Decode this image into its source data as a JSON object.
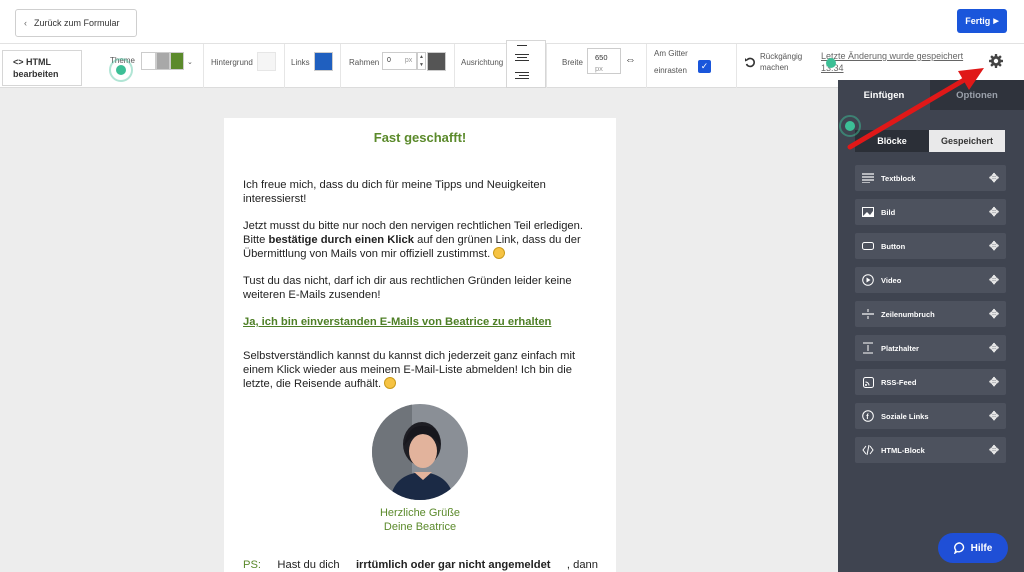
{
  "topbar": {
    "back_label": "Zurück zum Formular",
    "done_label": "Fertig"
  },
  "toolbar": {
    "html_label_line1": "HTML",
    "html_label_line2": "bearbeiten",
    "theme_label": "Theme",
    "background_label": "Hintergrund",
    "links_label": "Links",
    "frame_label": "Rahmen",
    "frame_value": "0",
    "frame_unit": "px",
    "alignment_label": "Ausrichtung",
    "width_label": "Breite",
    "width_value": "650",
    "width_unit": "px",
    "grid_label_line1": "Am Gitter",
    "grid_label_line2": "einrasten",
    "undo_label_line1": "Rückgängig",
    "undo_label_line2": "machen",
    "last_change": "Letzte Änderung wurde gespeichert 13:34",
    "colors": {
      "theme_1": "#ffffff",
      "theme_2": "#a8a8a8",
      "theme_3": "#5b8a2b",
      "links": "#1f5fbf",
      "frame": "#555555",
      "background": "#f5f5f5"
    }
  },
  "mail": {
    "title": "Fast geschafft!",
    "p1": "Ich freue mich, dass du dich für meine Tipps und Neuigkeiten interessierst!",
    "p2_a": "Jetzt musst du bitte nur noch den nervigen rechtlichen Teil erledigen. Bitte ",
    "p2_bold": "bestätige durch einen Klick",
    "p2_b": " auf den grünen Link, dass du der Übermittlung von Mails von mir offiziell zustimmst.",
    "p3": "Tust du das nicht, darf ich dir aus rechtlichen Gründen leider keine weiteren E-Mails zusenden!",
    "link": "Ja, ich bin einverstanden E-Mails von Beatrice zu erhalten",
    "p4": "Selbstverständlich kannst du kannst dich jederzeit ganz einfach mit einem Klick wieder aus meinem E-Mail-Liste abmelden! Ich bin die letzte, die Reisende aufhält.",
    "greeting1": "Herzliche Grüße",
    "greeting2": "Deine Beatrice",
    "ps_label": "PS:",
    "ps_a": "Hast du dich",
    "ps_bold": "irrtümlich oder gar nicht angemeldet",
    "ps_b": ", dann"
  },
  "panel": {
    "tab_insert": "Einfügen",
    "tab_options": "Optionen",
    "seg_blocks": "Blöcke",
    "seg_saved": "Gespeichert",
    "blocks": [
      {
        "label": "Textblock",
        "icon": "text-icon"
      },
      {
        "label": "Bild",
        "icon": "image-icon"
      },
      {
        "label": "Button",
        "icon": "button-icon"
      },
      {
        "label": "Video",
        "icon": "video-icon"
      },
      {
        "label": "Zeilenumbruch",
        "icon": "line-break-icon"
      },
      {
        "label": "Platzhalter",
        "icon": "placeholder-icon"
      },
      {
        "label": "RSS-Feed",
        "icon": "rss-icon"
      },
      {
        "label": "Soziale Links",
        "icon": "social-icon"
      },
      {
        "label": "HTML-Block",
        "icon": "code-icon"
      }
    ]
  },
  "help": {
    "label": "Hilfe"
  }
}
